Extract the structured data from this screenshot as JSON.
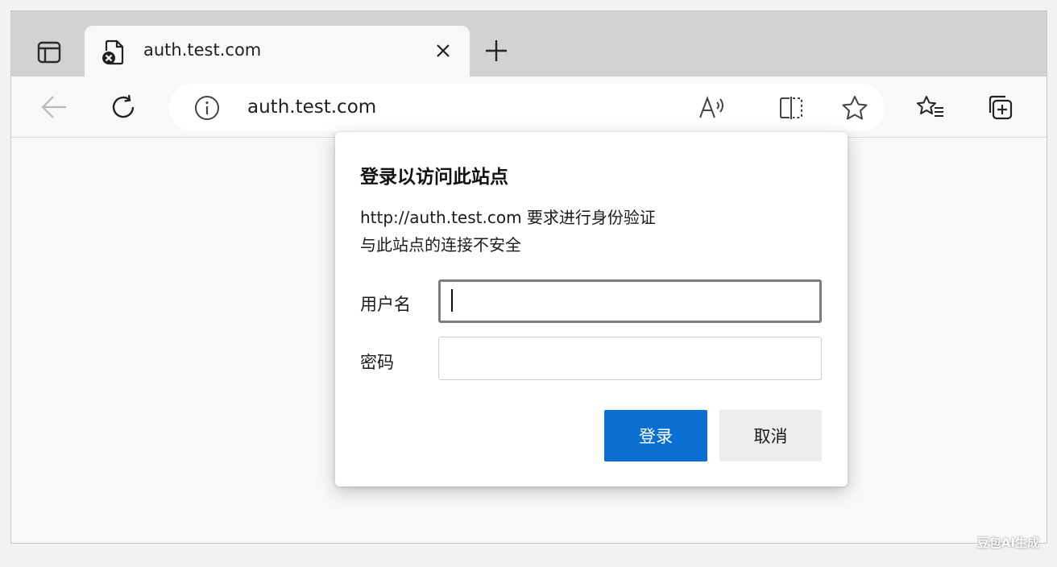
{
  "tab": {
    "title": "auth.test.com",
    "favicon": "page-error-icon"
  },
  "address_bar": {
    "url": "auth.test.com",
    "site_info_icon": "info-icon"
  },
  "toolbar": {
    "icons": [
      "back-arrow-icon",
      "refresh-icon",
      "read-aloud-icon",
      "split-screen-icon",
      "favorite-star-icon",
      "favorites-list-icon",
      "collections-icon"
    ]
  },
  "dialog": {
    "title": "登录以访问此站点",
    "message_line1": "http://auth.test.com 要求进行身份验证",
    "message_line2": "与此站点的连接不安全",
    "username_label": "用户名",
    "username_value": "",
    "password_label": "密码",
    "password_value": "",
    "submit_label": "登录",
    "cancel_label": "取消"
  },
  "watermark": "豆包AI生成",
  "colors": {
    "primary_button": "#0a6fd0",
    "tabstrip": "#d2d2d2",
    "page_background": "#f8f8f8"
  }
}
